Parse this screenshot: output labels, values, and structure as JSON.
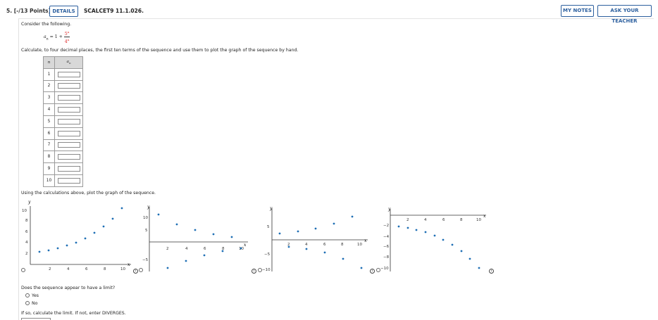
{
  "header": {
    "question_number": "5.",
    "points": "[-/13 Points]",
    "details_label": "DETAILS",
    "code": "SCALCET9 11.1.026.",
    "notes_label": "MY NOTES",
    "ask_label": "ASK YOUR TEACHER"
  },
  "problem": {
    "intro": "Consider the following.",
    "formula_lhs": "a",
    "formula_sub": "n",
    "formula_mid": " = 1 + ",
    "formula_num": "5",
    "formula_num_exp": "n",
    "formula_den": "4",
    "formula_den_exp": "n",
    "instruction": "Calculate, to four decimal places, the first ten terms of the sequence and use them to plot the graph of the sequence by hand."
  },
  "table": {
    "col_n": "n",
    "col_a": "a",
    "col_a_sub": "n",
    "rows": [
      "1",
      "2",
      "3",
      "4",
      "5",
      "6",
      "7",
      "8",
      "9",
      "10"
    ]
  },
  "plot_prompt": "Using the calculations above, plot the graph of the sequence.",
  "graphs": {
    "axis_x_label": "x",
    "axis_y_label": "y",
    "g1": {
      "xticks": [
        "2",
        "4",
        "6",
        "8",
        "10"
      ],
      "yticks": [
        "2",
        "4",
        "6",
        "8",
        "10"
      ]
    },
    "g2": {
      "xticks": [
        "2",
        "4",
        "6",
        "8",
        "10"
      ],
      "yticks": [
        "10",
        "5",
        "−5"
      ]
    },
    "g3": {
      "xticks": [
        "2",
        "4",
        "6",
        "8",
        "10"
      ],
      "yticks": [
        "5",
        "−5",
        "−10"
      ]
    },
    "g4": {
      "xticks": [
        "2",
        "4",
        "6",
        "8",
        "10"
      ],
      "yticks": [
        "−2",
        "−4",
        "−6",
        "−8",
        "−10"
      ]
    }
  },
  "limit_question": {
    "prompt": "Does the sequence appear to have a limit?",
    "options": [
      "Yes",
      "No"
    ],
    "followup": "If so, calculate the limit. If not, enter DIVERGES."
  },
  "colors": {
    "accent": "#2c5f9e",
    "point": "#1f6fb5",
    "formula_red": "#d22222"
  }
}
